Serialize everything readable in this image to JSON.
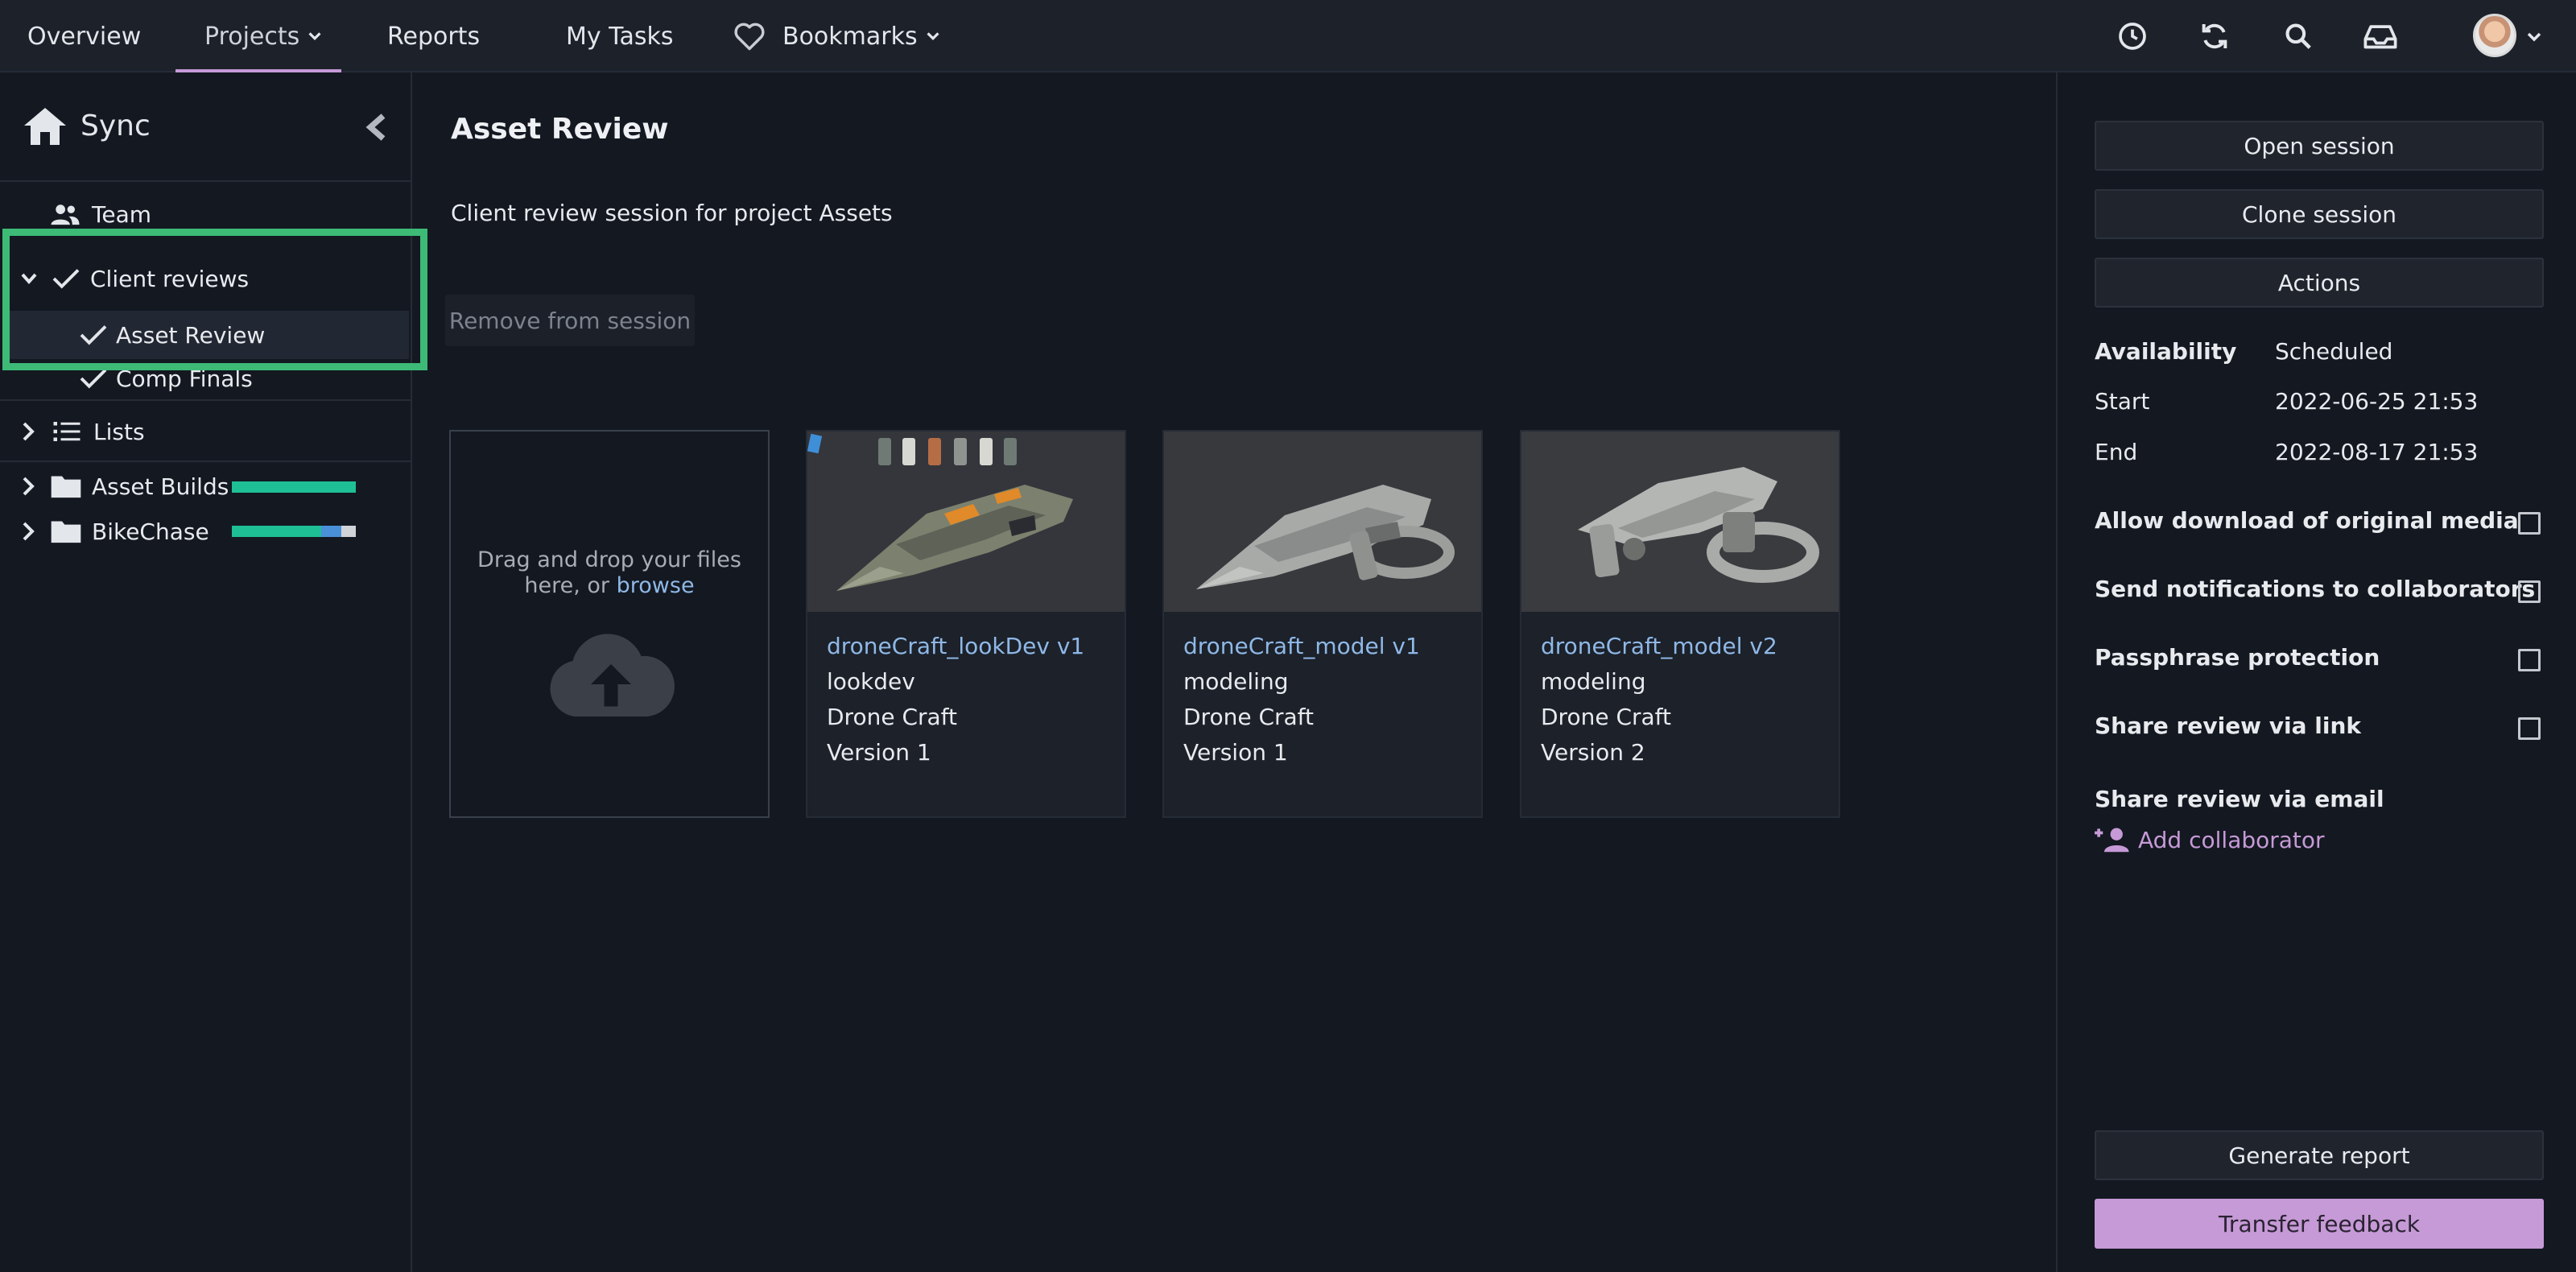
{
  "topnav": {
    "items": [
      {
        "label": "Overview"
      },
      {
        "label": "Projects"
      },
      {
        "label": "Reports"
      },
      {
        "label": "My Tasks"
      },
      {
        "label": "Bookmarks"
      }
    ],
    "active": "Projects",
    "right_icons": [
      "clock-icon",
      "sync-icon",
      "search-icon",
      "inbox-icon"
    ]
  },
  "sidebar": {
    "title": "Sync",
    "items": [
      {
        "label": "Team",
        "icon": "team-icon"
      },
      {
        "label": "Client reviews",
        "icon": "check-icon",
        "expanded": true
      },
      {
        "label": "Asset Review",
        "icon": "check-icon",
        "selected": true
      },
      {
        "label": "Comp Finals",
        "icon": "check-icon"
      },
      {
        "label": "Lists",
        "icon": "list-icon"
      },
      {
        "label": "Asset Builds",
        "icon": "folder-icon",
        "progress": [
          {
            "color": "#1fbf96",
            "fraction": 1.0
          }
        ]
      },
      {
        "label": "BikeChase",
        "icon": "folder-icon",
        "progress": [
          {
            "color": "#1fbf96",
            "fraction": 0.72
          },
          {
            "color": "#4a90d9",
            "fraction": 0.16
          },
          {
            "color": "#d0d3d8",
            "fraction": 0.12
          }
        ]
      }
    ]
  },
  "main": {
    "title": "Asset Review",
    "subtitle": "Client review session for project Assets",
    "remove_label": "Remove from session",
    "dropzone": {
      "text": "Drag and drop your files here, or",
      "link": "browse"
    },
    "cards": [
      {
        "name": "droneCraft_lookDev v1",
        "task": "lookdev",
        "asset": "Drone Craft",
        "version": "Version 1"
      },
      {
        "name": "droneCraft_model v1",
        "task": "modeling",
        "asset": "Drone Craft",
        "version": "Version 1"
      },
      {
        "name": "droneCraft_model v2",
        "task": "modeling",
        "asset": "Drone Craft",
        "version": "Version 2"
      }
    ]
  },
  "panel": {
    "buttons": {
      "open": "Open session",
      "clone": "Clone session",
      "actions": "Actions"
    },
    "availability": {
      "label": "Availability",
      "value": "Scheduled"
    },
    "start": {
      "label": "Start",
      "value": "2022-06-25 21:53"
    },
    "end": {
      "label": "End",
      "value": "2022-08-17 21:53"
    },
    "options": [
      {
        "label": "Allow download of original media",
        "checked": false
      },
      {
        "label": "Send notifications to collaborators",
        "checked": false
      },
      {
        "label": "Passphrase protection",
        "checked": false
      },
      {
        "label": "Share review via link",
        "checked": false
      }
    ],
    "email_label": "Share review via email",
    "add_collaborator": "Add collaborator",
    "generate_report": "Generate report",
    "transfer_feedback": "Transfer feedback"
  },
  "colors": {
    "accent": "#c69ad6",
    "link": "#8fb8e6",
    "highlight": "#3dbb76"
  }
}
